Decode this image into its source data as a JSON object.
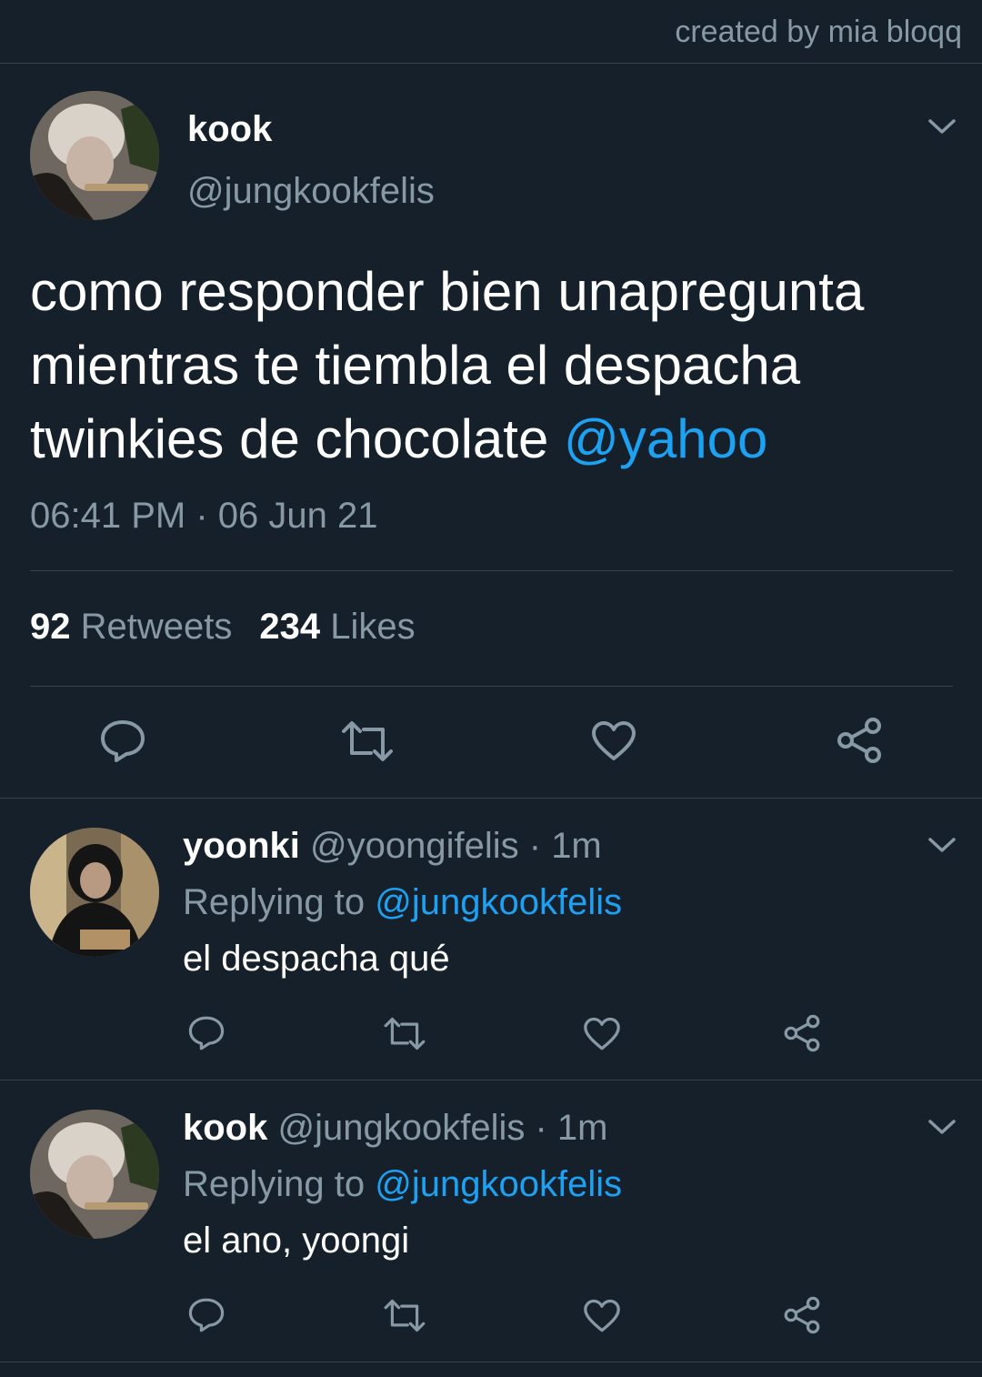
{
  "credit": "created by mia bloqq",
  "colors": {
    "background": "#15202b",
    "divider": "#38444d",
    "secondary_text": "#8899a6",
    "accent": "#1da1f2"
  },
  "main_tweet": {
    "name": "kook",
    "handle": "@jungkookfelis",
    "text": "como responder bien unapregunta mientras te tiembla el despacha twinkies de chocolate ",
    "mention": "@yahoo",
    "timestamp": "06:41 PM · 06 Jun 21",
    "retweets_count": "92",
    "retweets_label": "Retweets",
    "likes_count": "234",
    "likes_label": "Likes",
    "menu_icon": "chevron-down-icon",
    "actions": [
      "reply-icon",
      "retweet-icon",
      "like-icon",
      "share-icon"
    ]
  },
  "replies": [
    {
      "name": "yoonki",
      "handle": "@yoongifelis",
      "time": " · 1m",
      "replying_prefix": "Replying to ",
      "replying_to": "@jungkookfelis",
      "text": "el despacha qué"
    },
    {
      "name": "kook",
      "handle": "@jungkookfelis",
      "time": " · 1m",
      "replying_prefix": "Replying to ",
      "replying_to": "@jungkookfelis",
      "text": "el ano, yoongi"
    }
  ]
}
